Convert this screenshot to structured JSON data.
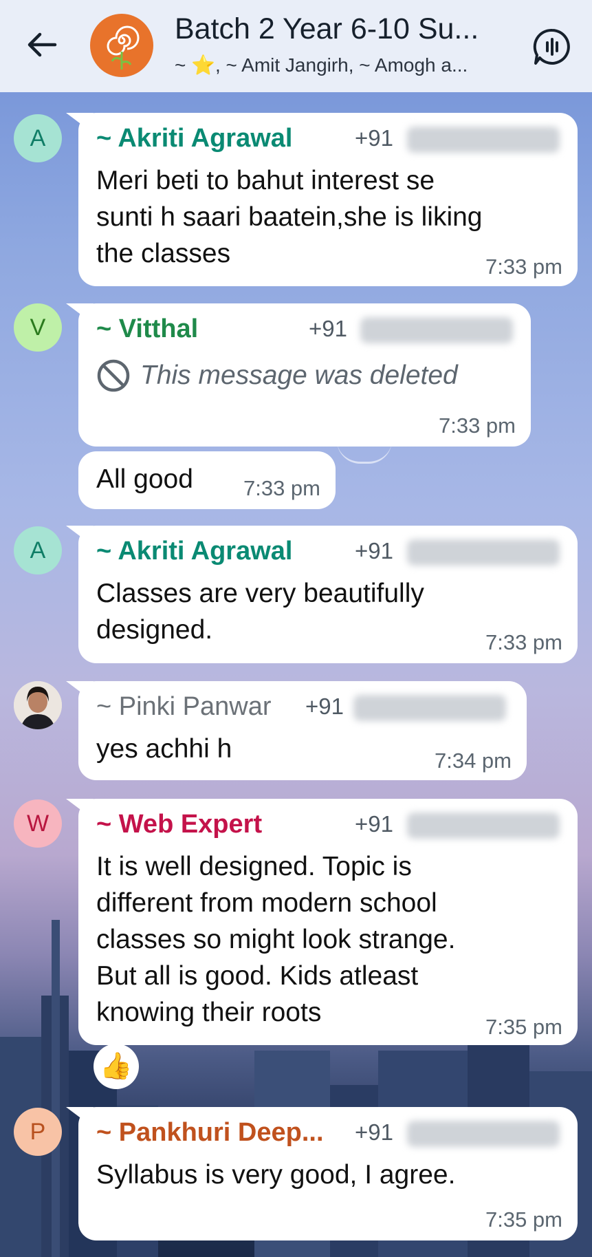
{
  "header": {
    "title": "Batch 2 Year 6-10 Su...",
    "subtitle": "~ ⭐, ~ Amit Jangirh, ~ Amogh a...",
    "back_icon": "arrow-left-icon",
    "group_icon": "spiral-plant-icon",
    "audio_icon": "voice-chat-icon"
  },
  "messages": [
    {
      "avatar": "A",
      "sender": "~ Akriti Agrawal",
      "phone": "+91",
      "lines": [
        "Meri beti to bahut interest se",
        "sunti h saari baatein,she is liking",
        "the classes"
      ],
      "time": "7:33 pm"
    },
    {
      "avatar": "V",
      "sender": "~ Vitthal",
      "phone": "+91",
      "deleted_text": "This message was deleted",
      "time": "7:33 pm"
    },
    {
      "text": "All good",
      "time": "7:33 pm"
    },
    {
      "avatar": "A",
      "sender": "~ Akriti Agrawal",
      "phone": "+91",
      "lines": [
        "Classes are very beautifully",
        "designed."
      ],
      "time": "7:33 pm"
    },
    {
      "sender": "~ Pinki Panwar",
      "phone": "+91",
      "lines": [
        "yes achhi h"
      ],
      "time": "7:34 pm"
    },
    {
      "avatar": "W",
      "sender": "~ Web Expert",
      "phone": "+91",
      "lines": [
        "It is well designed. Topic is",
        "different from modern school",
        "classes so might look strange.",
        "But all is good. Kids atleast",
        "knowing their roots"
      ],
      "time": "7:35 pm",
      "reaction": "👍"
    },
    {
      "avatar": "P",
      "sender": "~ Pankhuri Deep...",
      "phone": "+91",
      "lines": [
        "Syllabus is very good, I agree."
      ],
      "time": "7:35 pm"
    }
  ],
  "colors": {
    "akriti": "#0a8a73",
    "vitthal": "#1f8a4a",
    "pinki": "#6b7177",
    "web_expert": "#c4124a",
    "pankhuri": "#c0511d"
  }
}
